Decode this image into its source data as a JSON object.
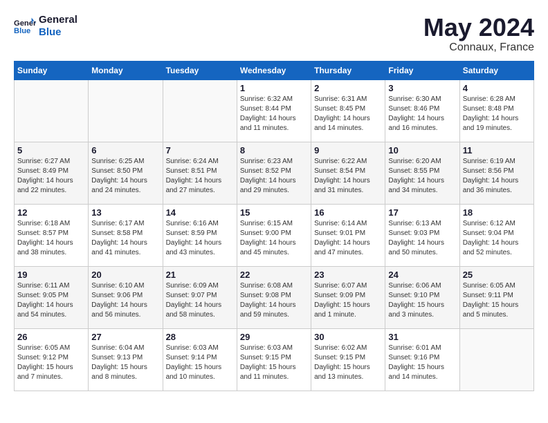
{
  "header": {
    "logo_line1": "General",
    "logo_line2": "Blue",
    "month": "May 2024",
    "location": "Connaux, France"
  },
  "weekdays": [
    "Sunday",
    "Monday",
    "Tuesday",
    "Wednesday",
    "Thursday",
    "Friday",
    "Saturday"
  ],
  "weeks": [
    [
      {
        "day": "",
        "info": ""
      },
      {
        "day": "",
        "info": ""
      },
      {
        "day": "",
        "info": ""
      },
      {
        "day": "1",
        "info": "Sunrise: 6:32 AM\nSunset: 8:44 PM\nDaylight: 14 hours\nand 11 minutes."
      },
      {
        "day": "2",
        "info": "Sunrise: 6:31 AM\nSunset: 8:45 PM\nDaylight: 14 hours\nand 14 minutes."
      },
      {
        "day": "3",
        "info": "Sunrise: 6:30 AM\nSunset: 8:46 PM\nDaylight: 14 hours\nand 16 minutes."
      },
      {
        "day": "4",
        "info": "Sunrise: 6:28 AM\nSunset: 8:48 PM\nDaylight: 14 hours\nand 19 minutes."
      }
    ],
    [
      {
        "day": "5",
        "info": "Sunrise: 6:27 AM\nSunset: 8:49 PM\nDaylight: 14 hours\nand 22 minutes."
      },
      {
        "day": "6",
        "info": "Sunrise: 6:25 AM\nSunset: 8:50 PM\nDaylight: 14 hours\nand 24 minutes."
      },
      {
        "day": "7",
        "info": "Sunrise: 6:24 AM\nSunset: 8:51 PM\nDaylight: 14 hours\nand 27 minutes."
      },
      {
        "day": "8",
        "info": "Sunrise: 6:23 AM\nSunset: 8:52 PM\nDaylight: 14 hours\nand 29 minutes."
      },
      {
        "day": "9",
        "info": "Sunrise: 6:22 AM\nSunset: 8:54 PM\nDaylight: 14 hours\nand 31 minutes."
      },
      {
        "day": "10",
        "info": "Sunrise: 6:20 AM\nSunset: 8:55 PM\nDaylight: 14 hours\nand 34 minutes."
      },
      {
        "day": "11",
        "info": "Sunrise: 6:19 AM\nSunset: 8:56 PM\nDaylight: 14 hours\nand 36 minutes."
      }
    ],
    [
      {
        "day": "12",
        "info": "Sunrise: 6:18 AM\nSunset: 8:57 PM\nDaylight: 14 hours\nand 38 minutes."
      },
      {
        "day": "13",
        "info": "Sunrise: 6:17 AM\nSunset: 8:58 PM\nDaylight: 14 hours\nand 41 minutes."
      },
      {
        "day": "14",
        "info": "Sunrise: 6:16 AM\nSunset: 8:59 PM\nDaylight: 14 hours\nand 43 minutes."
      },
      {
        "day": "15",
        "info": "Sunrise: 6:15 AM\nSunset: 9:00 PM\nDaylight: 14 hours\nand 45 minutes."
      },
      {
        "day": "16",
        "info": "Sunrise: 6:14 AM\nSunset: 9:01 PM\nDaylight: 14 hours\nand 47 minutes."
      },
      {
        "day": "17",
        "info": "Sunrise: 6:13 AM\nSunset: 9:03 PM\nDaylight: 14 hours\nand 50 minutes."
      },
      {
        "day": "18",
        "info": "Sunrise: 6:12 AM\nSunset: 9:04 PM\nDaylight: 14 hours\nand 52 minutes."
      }
    ],
    [
      {
        "day": "19",
        "info": "Sunrise: 6:11 AM\nSunset: 9:05 PM\nDaylight: 14 hours\nand 54 minutes."
      },
      {
        "day": "20",
        "info": "Sunrise: 6:10 AM\nSunset: 9:06 PM\nDaylight: 14 hours\nand 56 minutes."
      },
      {
        "day": "21",
        "info": "Sunrise: 6:09 AM\nSunset: 9:07 PM\nDaylight: 14 hours\nand 58 minutes."
      },
      {
        "day": "22",
        "info": "Sunrise: 6:08 AM\nSunset: 9:08 PM\nDaylight: 14 hours\nand 59 minutes."
      },
      {
        "day": "23",
        "info": "Sunrise: 6:07 AM\nSunset: 9:09 PM\nDaylight: 15 hours\nand 1 minute."
      },
      {
        "day": "24",
        "info": "Sunrise: 6:06 AM\nSunset: 9:10 PM\nDaylight: 15 hours\nand 3 minutes."
      },
      {
        "day": "25",
        "info": "Sunrise: 6:05 AM\nSunset: 9:11 PM\nDaylight: 15 hours\nand 5 minutes."
      }
    ],
    [
      {
        "day": "26",
        "info": "Sunrise: 6:05 AM\nSunset: 9:12 PM\nDaylight: 15 hours\nand 7 minutes."
      },
      {
        "day": "27",
        "info": "Sunrise: 6:04 AM\nSunset: 9:13 PM\nDaylight: 15 hours\nand 8 minutes."
      },
      {
        "day": "28",
        "info": "Sunrise: 6:03 AM\nSunset: 9:14 PM\nDaylight: 15 hours\nand 10 minutes."
      },
      {
        "day": "29",
        "info": "Sunrise: 6:03 AM\nSunset: 9:15 PM\nDaylight: 15 hours\nand 11 minutes."
      },
      {
        "day": "30",
        "info": "Sunrise: 6:02 AM\nSunset: 9:15 PM\nDaylight: 15 hours\nand 13 minutes."
      },
      {
        "day": "31",
        "info": "Sunrise: 6:01 AM\nSunset: 9:16 PM\nDaylight: 15 hours\nand 14 minutes."
      },
      {
        "day": "",
        "info": ""
      }
    ]
  ]
}
